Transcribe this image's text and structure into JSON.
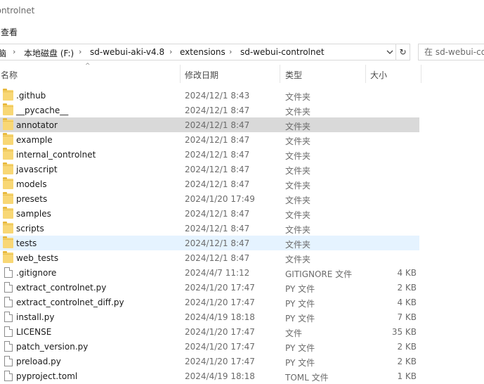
{
  "window": {
    "title": "controlnet"
  },
  "menu": {
    "view": "查看"
  },
  "address": {
    "crumbs": [
      "脑",
      "本地磁盘 (F:)",
      "sd-webui-aki-v4.8",
      "extensions",
      "sd-webui-controlnet"
    ],
    "separator": "›",
    "dropdown_icon": "chevron-down-icon",
    "refresh_icon": "↻"
  },
  "search": {
    "placeholder": "在 sd-webui-co"
  },
  "columns": {
    "name": "名称",
    "date": "修改日期",
    "type": "类型",
    "size": "大小",
    "sort_indicator": "^"
  },
  "rows": [
    {
      "name": ".github",
      "date": "2024/12/1 8:43",
      "type": "文件夹",
      "size": "",
      "kind": "folder"
    },
    {
      "name": "__pycache__",
      "date": "2024/12/1 8:47",
      "type": "文件夹",
      "size": "",
      "kind": "folder"
    },
    {
      "name": "annotator",
      "date": "2024/12/1 8:47",
      "type": "文件夹",
      "size": "",
      "kind": "folder",
      "state": "selected"
    },
    {
      "name": "example",
      "date": "2024/12/1 8:47",
      "type": "文件夹",
      "size": "",
      "kind": "folder"
    },
    {
      "name": "internal_controlnet",
      "date": "2024/12/1 8:47",
      "type": "文件夹",
      "size": "",
      "kind": "folder"
    },
    {
      "name": "javascript",
      "date": "2024/12/1 8:47",
      "type": "文件夹",
      "size": "",
      "kind": "folder"
    },
    {
      "name": "models",
      "date": "2024/12/1 8:47",
      "type": "文件夹",
      "size": "",
      "kind": "folder"
    },
    {
      "name": "presets",
      "date": "2024/1/20 17:49",
      "type": "文件夹",
      "size": "",
      "kind": "folder"
    },
    {
      "name": "samples",
      "date": "2024/12/1 8:47",
      "type": "文件夹",
      "size": "",
      "kind": "folder"
    },
    {
      "name": "scripts",
      "date": "2024/12/1 8:47",
      "type": "文件夹",
      "size": "",
      "kind": "folder"
    },
    {
      "name": "tests",
      "date": "2024/12/1 8:47",
      "type": "文件夹",
      "size": "",
      "kind": "folder",
      "state": "hover"
    },
    {
      "name": "web_tests",
      "date": "2024/12/1 8:47",
      "type": "文件夹",
      "size": "",
      "kind": "folder"
    },
    {
      "name": ".gitignore",
      "date": "2024/4/7 11:12",
      "type": "GITIGNORE 文件",
      "size": "4 KB",
      "kind": "file"
    },
    {
      "name": "extract_controlnet.py",
      "date": "2024/1/20 17:47",
      "type": "PY 文件",
      "size": "2 KB",
      "kind": "file"
    },
    {
      "name": "extract_controlnet_diff.py",
      "date": "2024/1/20 17:47",
      "type": "PY 文件",
      "size": "4 KB",
      "kind": "file"
    },
    {
      "name": "install.py",
      "date": "2024/4/19 18:18",
      "type": "PY 文件",
      "size": "7 KB",
      "kind": "file"
    },
    {
      "name": "LICENSE",
      "date": "2024/1/20 17:47",
      "type": "文件",
      "size": "35 KB",
      "kind": "file"
    },
    {
      "name": "patch_version.py",
      "date": "2024/1/20 17:47",
      "type": "PY 文件",
      "size": "2 KB",
      "kind": "file"
    },
    {
      "name": "preload.py",
      "date": "2024/1/20 17:47",
      "type": "PY 文件",
      "size": "2 KB",
      "kind": "file"
    },
    {
      "name": "pyproject.toml",
      "date": "2024/4/19 18:18",
      "type": "TOML 文件",
      "size": "1 KB",
      "kind": "file"
    }
  ],
  "colors": {
    "selected": "#d9d9d9",
    "hover": "#e5f3ff",
    "folder": "#f8d775",
    "secondary_text": "#6b6b6b"
  }
}
